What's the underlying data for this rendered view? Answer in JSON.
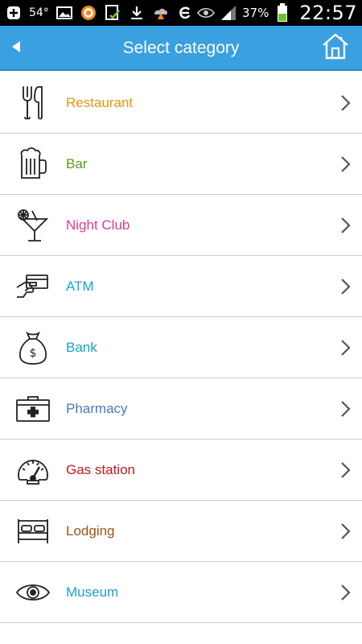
{
  "status_bar": {
    "temperature": "54°",
    "battery": "37%",
    "time": "22:57"
  },
  "header": {
    "title": "Select category",
    "back_icon": "back-arrow-icon",
    "home_icon": "home-icon"
  },
  "categories": [
    {
      "label": "Restaurant",
      "icon": "fork-knife-icon",
      "color": "#e8960f"
    },
    {
      "label": "Bar",
      "icon": "beer-mug-icon",
      "color": "#5a9a1e"
    },
    {
      "label": "Night Club",
      "icon": "cocktail-icon",
      "color": "#e23c8a"
    },
    {
      "label": "ATM",
      "icon": "card-hand-icon",
      "color": "#1aa6d6"
    },
    {
      "label": "Bank",
      "icon": "money-bag-icon",
      "color": "#1aa0c8"
    },
    {
      "label": "Pharmacy",
      "icon": "first-aid-kit-icon",
      "color": "#4a78c4"
    },
    {
      "label": "Gas station",
      "icon": "speedometer-icon",
      "color": "#c8161e"
    },
    {
      "label": "Lodging",
      "icon": "bed-icon",
      "color": "#a0521e"
    },
    {
      "label": "Museum",
      "icon": "eye-icon",
      "color": "#1aa0c8"
    }
  ],
  "colors": {
    "app_bar": "#3aa0e0",
    "status_bar": "#000000",
    "divider": "#c9c9c9",
    "chevron": "#555555"
  }
}
